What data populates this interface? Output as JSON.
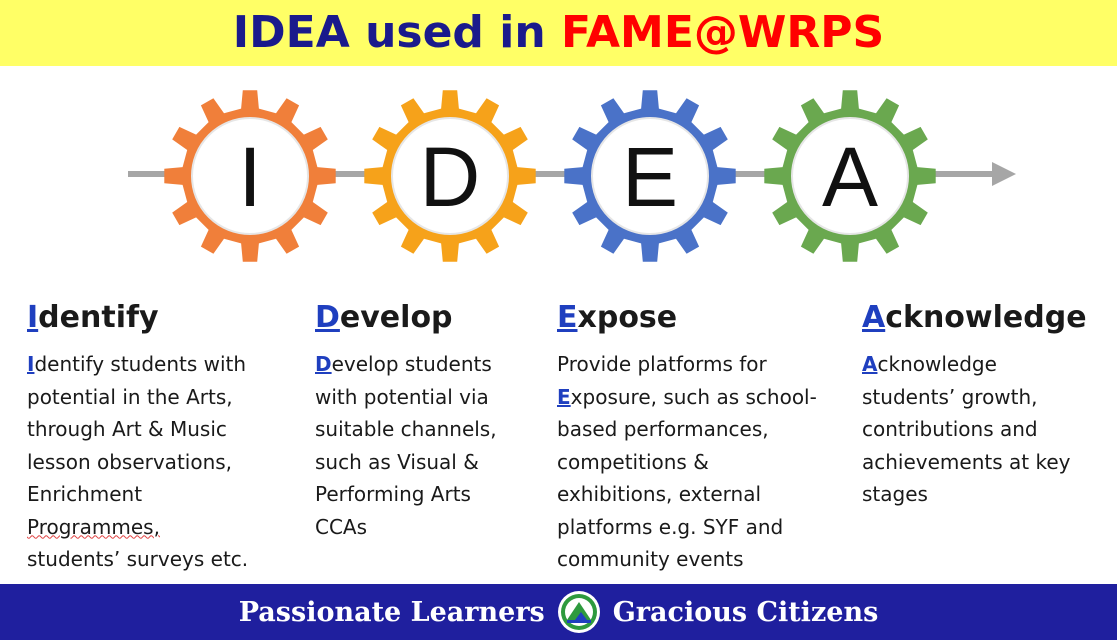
{
  "title": {
    "prefix": "IDEA used in ",
    "highlight": "FAME@WRPS"
  },
  "gears": [
    {
      "letter": "I",
      "color": "#f07f3a"
    },
    {
      "letter": "D",
      "color": "#f6a21a"
    },
    {
      "letter": "E",
      "color": "#4a72c8"
    },
    {
      "letter": "A",
      "color": "#6aa84f"
    }
  ],
  "arrow_color": "#a6a6a6",
  "columns": [
    {
      "heading_initial": "I",
      "heading_rest": "dentify",
      "desc_initial": "I",
      "desc_lines": [
        "dentify students with",
        "potential in the Arts,",
        "through Art & Music",
        "lesson observations,",
        "Enrichment"
      ],
      "desc_squiggle": "Programmes,",
      "desc_last": "students’ surveys etc."
    },
    {
      "heading_initial": "D",
      "heading_rest": "evelop",
      "desc_initial": "D",
      "desc_lines": [
        "evelop students",
        "with potential via",
        "suitable channels,",
        "such as Visual &",
        "Performing Arts",
        "CCAs"
      ]
    },
    {
      "heading_initial": "E",
      "heading_rest": "xpose",
      "desc_first": "Provide platforms for",
      "desc_initial": "E",
      "desc_lines": [
        "xposure, such as school-",
        "based performances,",
        "competitions &",
        "exhibitions, external",
        "platforms e.g. SYF and",
        "community events"
      ]
    },
    {
      "heading_initial": "A",
      "heading_rest": "cknowledge",
      "desc_initial": "A",
      "desc_lines": [
        "cknowledge",
        "students’ growth,",
        "contributions and",
        "achievements at key",
        "stages"
      ]
    }
  ],
  "footer": {
    "left": "Passionate Learners",
    "right": "Gracious Citizens",
    "logo_icon": "school-crest-icon"
  }
}
